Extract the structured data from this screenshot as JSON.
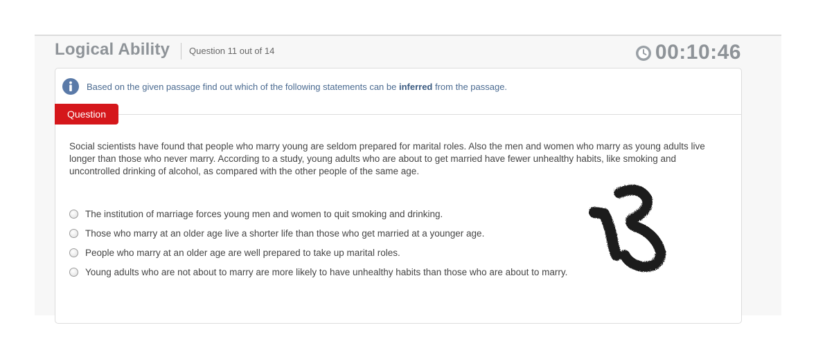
{
  "header": {
    "section_title": "Logical Ability",
    "question_counter": "Question 11 out of 14",
    "timer": "00:10:46",
    "clock_icon": "clock-icon"
  },
  "instruction": {
    "icon": "info-icon",
    "text_before": "Based on the given passage find out which of the following statements can be ",
    "text_bold": "inferred",
    "text_after": " from the passage."
  },
  "question_tab": {
    "label": "Question"
  },
  "passage": "Social scientists have found that people who marry young are seldom prepared for marital roles. Also the men and women who marry as young adults live longer than those who never marry. According to a study, young adults who are about to get married have fewer unhealthy habits, like smoking and uncontrolled drinking of alcohol, as compared with the other people of the same age.",
  "options": [
    {
      "label": "The institution of marriage forces young men and women to quit smoking and drinking.",
      "selected": false
    },
    {
      "label": "Those who marry at an older age live a shorter life than those who get married at a younger age.",
      "selected": false
    },
    {
      "label": "People who marry at an older age are well prepared to take up marital roles.",
      "selected": false
    },
    {
      "label": "Young adults who are not about to marry are more likely to have unhealthy habits than those who are about to marry.",
      "selected": false
    }
  ],
  "colors": {
    "accent_red": "#d5171b",
    "title_gray": "#8e9398",
    "info_blue": "#4a6a90"
  }
}
